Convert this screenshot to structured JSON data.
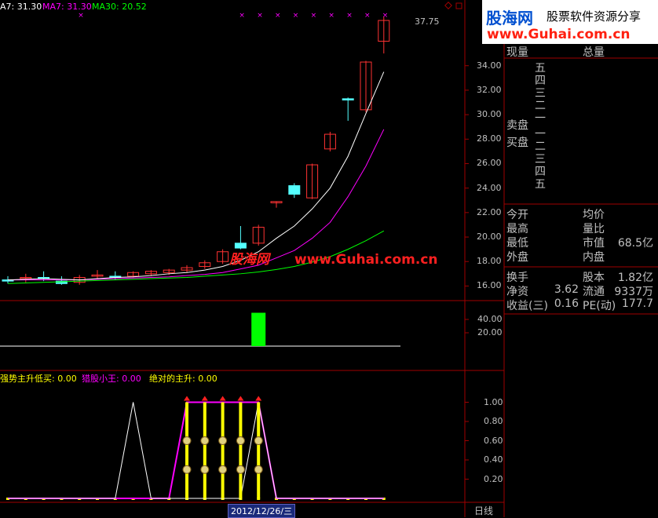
{
  "ma_labels": {
    "ma5": "A7: 31.30",
    "ma7": "MA7: 31.30",
    "ma30": "MA30: 20.52"
  },
  "indicator_labels": {
    "a": "强势主升低买: 0.00",
    "b": "猎股小王: 0.00",
    "c": "绝对的主升: 0.00"
  },
  "price_axis_ticks": [
    "34.00",
    "32.00",
    "30.00",
    "28.00",
    "26.00",
    "24.00",
    "22.00",
    "20.00",
    "18.00",
    "16.00"
  ],
  "volume_axis_ticks": [
    "40.00",
    "20.00"
  ],
  "indicator_axis_ticks": [
    "1.00",
    "0.80",
    "0.60",
    "0.40",
    "0.20"
  ],
  "high_marker": "37.75",
  "date_label": "2012/12/26/三",
  "period_label": "日线",
  "watermark": {
    "brand_cn": "股海网",
    "slogan": "股票软件资源分享",
    "url": "www.Guhai.com.cn",
    "chart_brand": "股海网",
    "chart_url": "www.Guhai.com.cn"
  },
  "panel": {
    "header_left": "现量",
    "header_right": "总量",
    "ask_labels": [
      "五",
      "四",
      "三",
      "二",
      "一"
    ],
    "bid_labels": [
      "一",
      "二",
      "三",
      "四",
      "五"
    ],
    "sell_label": "卖盘",
    "buy_label": "买盘",
    "quote_rows": [
      {
        "l": "今开",
        "lv": "",
        "r": "均价",
        "rv": ""
      },
      {
        "l": "最高",
        "lv": "",
        "r": "量比",
        "rv": ""
      },
      {
        "l": "最低",
        "lv": "",
        "r": "市值",
        "rv": "68.5亿"
      },
      {
        "l": "外盘",
        "lv": "",
        "r": "内盘",
        "rv": ""
      }
    ],
    "fund_rows": [
      {
        "l": "换手",
        "lv": "",
        "r": "股本",
        "rv": "1.82亿"
      },
      {
        "l": "净资",
        "lv": "3.62",
        "r": "流通",
        "rv": "9337万"
      },
      {
        "l": "收益(三)",
        "lv": "0.16",
        "r": "PE(动)",
        "rv": "177.7"
      }
    ]
  },
  "colors": {
    "up": "#ff3232",
    "down": "#54ffff",
    "ma_white": "#ffffff",
    "ma_magenta": "#ff00ff",
    "ma_green": "#00ff00",
    "grid_red": "#a00000",
    "axis_text": "#c0c0c0",
    "yellow": "#ffff00"
  },
  "chart_data": {
    "type": "candlestick",
    "y_range": [
      15.0,
      38.6
    ],
    "candles": [
      {
        "o": 16.5,
        "h": 16.8,
        "l": 16.2,
        "c": 16.4
      },
      {
        "o": 16.6,
        "h": 17.0,
        "l": 16.3,
        "c": 16.7
      },
      {
        "o": 16.7,
        "h": 17.2,
        "l": 16.4,
        "c": 16.6
      },
      {
        "o": 16.4,
        "h": 16.8,
        "l": 16.1,
        "c": 16.2
      },
      {
        "o": 16.3,
        "h": 16.9,
        "l": 16.1,
        "c": 16.7
      },
      {
        "o": 16.8,
        "h": 17.3,
        "l": 16.6,
        "c": 16.9
      },
      {
        "o": 16.8,
        "h": 17.2,
        "l": 16.5,
        "c": 16.7
      },
      {
        "o": 16.8,
        "h": 17.2,
        "l": 16.7,
        "c": 17.1
      },
      {
        "o": 17.0,
        "h": 17.3,
        "l": 16.8,
        "c": 17.2
      },
      {
        "o": 17.1,
        "h": 17.4,
        "l": 16.9,
        "c": 17.3
      },
      {
        "o": 17.3,
        "h": 17.7,
        "l": 17.1,
        "c": 17.5
      },
      {
        "o": 17.6,
        "h": 18.1,
        "l": 17.4,
        "c": 17.9
      },
      {
        "o": 18.0,
        "h": 19.0,
        "l": 17.8,
        "c": 18.8
      },
      {
        "o": 19.5,
        "h": 20.9,
        "l": 19.0,
        "c": 19.1
      },
      {
        "o": 19.5,
        "h": 21.0,
        "l": 19.3,
        "c": 20.8
      },
      {
        "o": 22.8,
        "h": 22.9,
        "l": 22.4,
        "c": 22.9
      },
      {
        "o": 24.2,
        "h": 24.4,
        "l": 23.2,
        "c": 23.5
      },
      {
        "o": 23.2,
        "h": 26.0,
        "l": 23.1,
        "c": 25.9
      },
      {
        "o": 27.2,
        "h": 28.6,
        "l": 27.0,
        "c": 28.4
      },
      {
        "o": 31.3,
        "h": 31.4,
        "l": 29.5,
        "c": 31.2
      },
      {
        "o": 30.4,
        "h": 34.4,
        "l": 30.2,
        "c": 34.3
      },
      {
        "o": 36.0,
        "h": 38.0,
        "l": 35.0,
        "c": 37.7
      }
    ],
    "ma_short": [
      16.5,
      16.55,
      16.6,
      16.55,
      16.5,
      16.6,
      16.7,
      16.75,
      16.85,
      17.0,
      17.1,
      17.3,
      17.6,
      18.1,
      18.8,
      19.9,
      20.9,
      22.3,
      24.0,
      26.6,
      30.1,
      33.5
    ],
    "ma_mid": [
      16.5,
      16.5,
      16.5,
      16.5,
      16.5,
      16.55,
      16.6,
      16.65,
      16.7,
      16.75,
      16.85,
      16.95,
      17.1,
      17.4,
      17.7,
      18.3,
      18.9,
      19.9,
      21.2,
      23.3,
      25.8,
      28.8
    ],
    "ma_long": [
      16.2,
      16.25,
      16.3,
      16.35,
      16.4,
      16.45,
      16.5,
      16.55,
      16.6,
      16.65,
      16.7,
      16.8,
      16.9,
      17.0,
      17.15,
      17.35,
      17.6,
      17.95,
      18.4,
      19.0,
      19.7,
      20.5
    ],
    "volume": [
      0,
      0,
      0,
      0,
      0,
      0,
      0,
      0,
      0,
      0,
      0,
      0,
      0,
      0,
      50,
      0,
      0,
      0,
      0,
      0,
      0,
      0
    ],
    "volume_range": [
      0,
      60
    ],
    "indicator_white": [
      0,
      0,
      0,
      0,
      0,
      0,
      0,
      1,
      0,
      0,
      0,
      0,
      0,
      0,
      1,
      0,
      0,
      0,
      0,
      0,
      0,
      0
    ],
    "indicator_magenta": [
      0,
      0,
      0,
      0,
      0,
      0,
      0,
      0,
      0,
      0,
      1,
      1,
      1,
      1,
      1,
      0,
      0,
      0,
      0,
      0,
      0,
      0
    ],
    "indicator_range": [
      0,
      1.2
    ]
  }
}
